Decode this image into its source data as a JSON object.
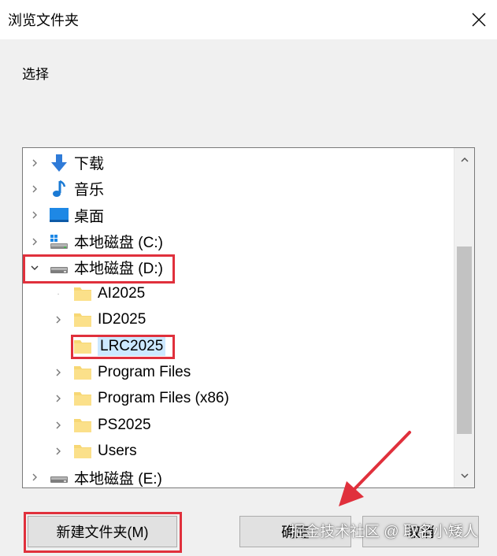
{
  "dialog": {
    "title": "浏览文件夹",
    "prompt": "选择"
  },
  "tree": {
    "items": [
      {
        "label": "下载",
        "icon": "download-icon",
        "expanded": false
      },
      {
        "label": "音乐",
        "icon": "music-icon",
        "expanded": false
      },
      {
        "label": "桌面",
        "icon": "desktop-icon",
        "expanded": false
      },
      {
        "label": "本地磁盘 (C:)",
        "icon": "system-drive-icon",
        "expanded": false
      },
      {
        "label": "本地磁盘 (D:)",
        "icon": "drive-icon",
        "expanded": true,
        "children": [
          {
            "label": "AI2025",
            "icon": "folder-icon"
          },
          {
            "label": "ID2025",
            "icon": "folder-icon"
          },
          {
            "label": "LRC2025",
            "icon": "folder-icon",
            "selected": true
          },
          {
            "label": "Program Files",
            "icon": "folder-icon"
          },
          {
            "label": "Program Files (x86)",
            "icon": "folder-icon"
          },
          {
            "label": "PS2025",
            "icon": "folder-icon"
          },
          {
            "label": "Users",
            "icon": "folder-icon"
          }
        ]
      },
      {
        "label": "本地磁盘 (E:)",
        "icon": "drive-icon",
        "expanded": false
      }
    ]
  },
  "buttons": {
    "new_folder": "新建文件夹(M)",
    "ok": "确定",
    "cancel": "取消"
  },
  "watermark": "掘金技术社区 @ 取名小矮人",
  "colors": {
    "highlight": "#e0303c",
    "selection": "#cce8ff",
    "folder": "#f7d774"
  }
}
